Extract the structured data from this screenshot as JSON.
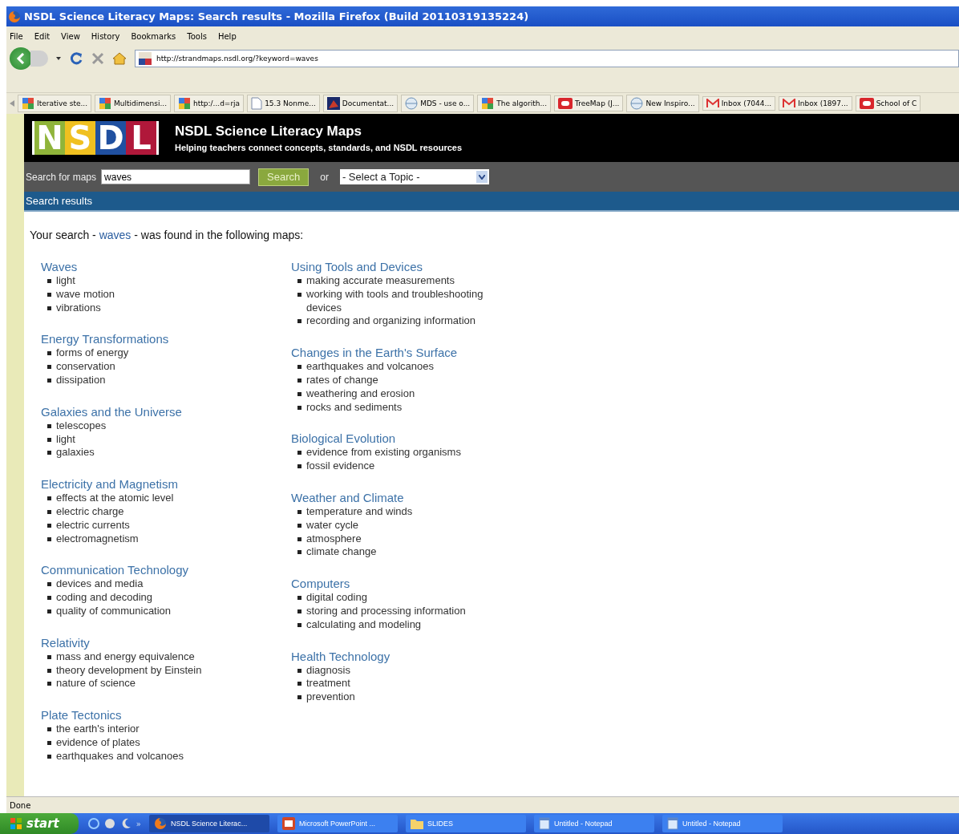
{
  "window": {
    "title": "NSDL Science Literacy Maps: Search results - Mozilla Firefox (Build 20110319135224)"
  },
  "menu": [
    "File",
    "Edit",
    "View",
    "History",
    "Bookmarks",
    "Tools",
    "Help"
  ],
  "address": {
    "value": "http://strandmaps.nsdl.org/?keyword=waves"
  },
  "bookmarks": [
    {
      "label": "Iterative ste...",
      "kind": "tiles"
    },
    {
      "label": "Multidimensi...",
      "kind": "tiles"
    },
    {
      "label": "http:/...d=rja",
      "kind": "tiles"
    },
    {
      "label": "15.3 Nonme...",
      "kind": "page"
    },
    {
      "label": "Documentat...",
      "kind": "dark"
    },
    {
      "label": "MDS - use o...",
      "kind": "globe"
    },
    {
      "label": "The algorith...",
      "kind": "tiles"
    },
    {
      "label": "TreeMap (J...",
      "kind": "badge"
    },
    {
      "label": "New Inspiro...",
      "kind": "globe"
    },
    {
      "label": "Inbox (7044...",
      "kind": "mail"
    },
    {
      "label": "Inbox (1897...",
      "kind": "mail"
    },
    {
      "label": "School of C",
      "kind": "badge"
    }
  ],
  "site": {
    "logo": [
      "N",
      "S",
      "D",
      "L"
    ],
    "title": "NSDL Science Literacy Maps",
    "subtitle": "Helping teachers connect concepts, standards, and NSDL resources"
  },
  "search": {
    "label": "Search for maps",
    "value": "waves",
    "button": "Search",
    "or": "or",
    "topic": "- Select a Topic -"
  },
  "band": "Search results",
  "heading": {
    "before": "Your search - ",
    "keyword": "waves",
    "after": " - was found in the following maps:"
  },
  "columns": [
    [
      {
        "title": "Waves",
        "items": [
          "light",
          "wave motion",
          "vibrations"
        ]
      },
      {
        "title": "Energy Transformations",
        "items": [
          "forms of energy",
          "conservation",
          "dissipation"
        ]
      },
      {
        "title": "Galaxies and the Universe",
        "items": [
          "telescopes",
          "light",
          "galaxies"
        ]
      },
      {
        "title": "Electricity and Magnetism",
        "items": [
          "effects at the atomic level",
          "electric charge",
          "electric currents",
          "electromagnetism"
        ]
      },
      {
        "title": "Communication Technology",
        "items": [
          "devices and media",
          "coding and decoding",
          "quality of communication"
        ]
      },
      {
        "title": "Relativity",
        "items": [
          "mass and energy equivalence",
          "theory development by Einstein",
          "nature of science"
        ]
      },
      {
        "title": "Plate Tectonics",
        "items": [
          "the earth's interior",
          "evidence of plates",
          "earthquakes and volcanoes"
        ]
      }
    ],
    [
      {
        "title": "Using Tools and Devices",
        "items": [
          "making accurate measurements",
          "working with tools and troubleshooting devices",
          "recording and organizing information"
        ]
      },
      {
        "title": "Changes in the Earth's Surface",
        "items": [
          "earthquakes and volcanoes",
          "rates of change",
          "weathering and erosion",
          "rocks and sediments"
        ]
      },
      {
        "title": "Biological Evolution",
        "items": [
          "evidence from existing organisms",
          "fossil evidence"
        ]
      },
      {
        "title": "Weather and Climate",
        "items": [
          "temperature and winds",
          "water cycle",
          "atmosphere",
          "climate change"
        ]
      },
      {
        "title": "Computers",
        "items": [
          "digital coding",
          "storing and processing information",
          "calculating and modeling"
        ]
      },
      {
        "title": "Health Technology",
        "items": [
          "diagnosis",
          "treatment",
          "prevention"
        ]
      }
    ]
  ],
  "status_bar": "Done",
  "taskbar": {
    "start": "start",
    "more": "»",
    "tasks": [
      {
        "label": "NSDL Science Literac...",
        "kind": "firefox",
        "selected": true
      },
      {
        "label": "Microsoft PowerPoint ...",
        "kind": "powerpoint",
        "selected": false
      },
      {
        "label": "SLIDES",
        "kind": "folder",
        "selected": false
      },
      {
        "label": "Untitled - Notepad",
        "kind": "notepad",
        "selected": false
      },
      {
        "label": "Untitled - Notepad",
        "kind": "notepad",
        "selected": false
      }
    ]
  }
}
